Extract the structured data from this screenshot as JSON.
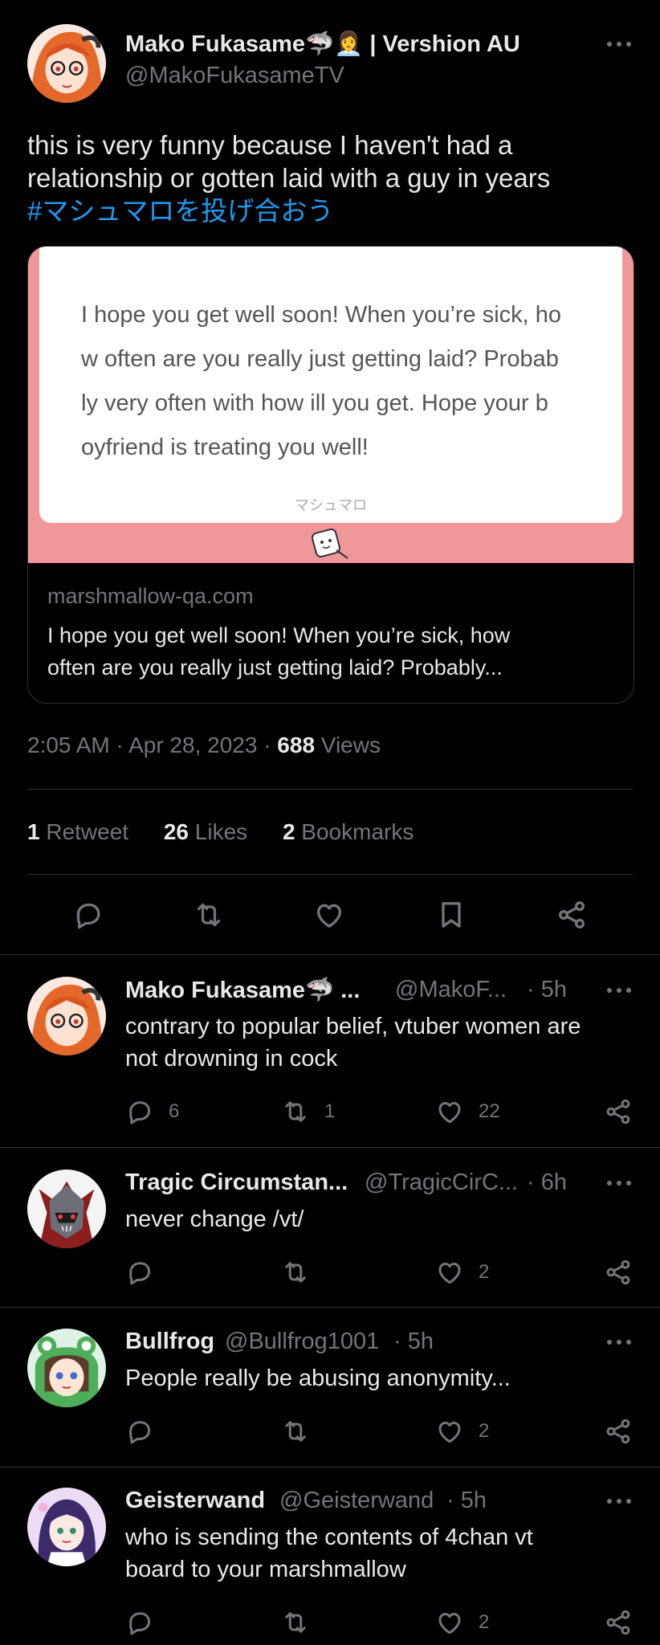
{
  "main_tweet": {
    "author_name": "Mako Fukasame🦈👩‍💼 | Vershion AU",
    "author_handle": "@MakoFukasameTV",
    "text_line1": "this is very funny because I haven't had a",
    "text_line2": "relationship or gotten laid with a guy in years",
    "hashtag": "#マシュマロを投げ合おう",
    "card": {
      "image_lines": [
        "I hope you get well soon! When you’re sick, ho",
        "w often are you really just getting laid? Probab",
        "ly very often with how ill you get. Hope your b",
        "oyfriend is treating you well!"
      ],
      "image_brand": "マシュマロ",
      "domain": "marshmallow-qa.com",
      "description_line1": "I hope you get well soon! When you’re sick, how",
      "description_line2": "often are you really just getting laid? Probably..."
    },
    "time": "2:05 AM · Apr 28, 2023 · ",
    "views_count": "688",
    "views_label": " Views",
    "stats": {
      "retweets_count": "1",
      "retweets_label": " Retweet",
      "likes_count": "26",
      "likes_label": " Likes",
      "bookmarks_count": "2",
      "bookmarks_label": " Bookmarks"
    }
  },
  "replies": [
    {
      "name": "Mako Fukasame🦈 ...",
      "handle": "@MakoF...",
      "time": "· 5h",
      "text_line1": "contrary to popular belief, vtuber women are",
      "text_line2": "not drowning in cock",
      "reply_count": "6",
      "retweet_count": "1",
      "like_count": "22"
    },
    {
      "name": "Tragic Circumstan...",
      "handle": "@TragicCirC...",
      "time": "· 6h",
      "text_line1": "never change /vt/",
      "reply_count": "",
      "retweet_count": "",
      "like_count": "2"
    },
    {
      "name": "Bullfrog",
      "handle": "@Bullfrog1001",
      "time": "· 5h",
      "text_line1": "People really be abusing anonymity...",
      "reply_count": "",
      "retweet_count": "",
      "like_count": "2"
    },
    {
      "name": "Geisterwand",
      "handle": "@Geisterwand",
      "time": "· 5h",
      "text_line1": "who is sending the contents of 4chan vt",
      "text_line2": "board to your marshmallow",
      "reply_count": "",
      "retweet_count": "",
      "like_count": "2"
    }
  ],
  "icons": [
    "reply-icon",
    "retweet-icon",
    "like-icon",
    "bookmark-icon",
    "share-icon",
    "more-icon"
  ],
  "colors": {
    "background": "#000000",
    "text": "#e7e9ea",
    "muted": "#71767b",
    "link": "#1d9bf0",
    "divider": "#2f3336",
    "card_pink": "#f0979a"
  }
}
